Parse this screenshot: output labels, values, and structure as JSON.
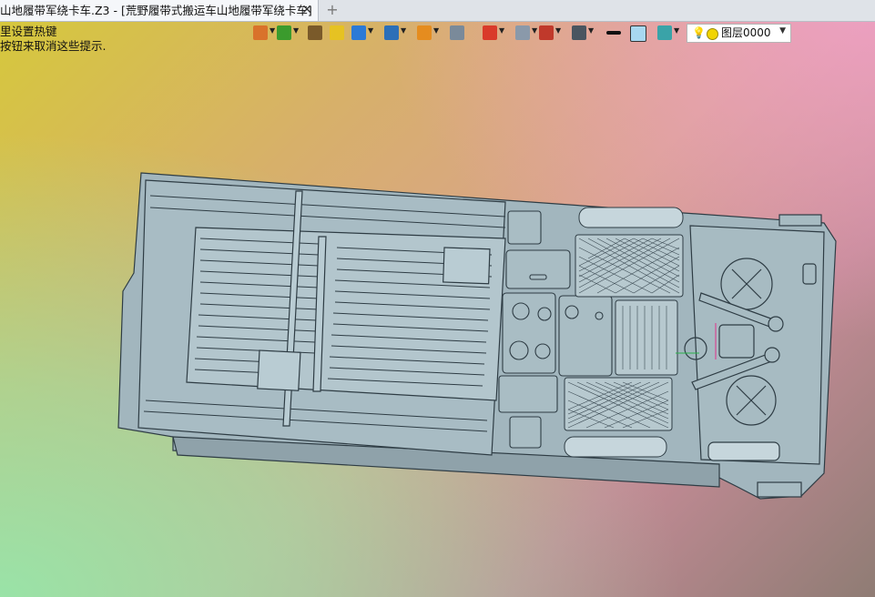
{
  "tab": {
    "title": "山地履带军绕卡车.Z3 - [荒野履带式搬运车山地履带军绕卡车]",
    "close_glyph": "✕",
    "new_tab_glyph": "+"
  },
  "hints": {
    "line1": "里设置热键",
    "line2": "按钮来取消这些提示."
  },
  "toolbar": {
    "icons": [
      {
        "name": "exit-icon",
        "color": "#d9722b"
      },
      {
        "name": "pick-filter-icon",
        "color": "#3b9b2d"
      },
      {
        "name": "brush-icon",
        "color": "#7a5a2a"
      },
      {
        "name": "solid-yellow-icon",
        "color": "#e6c222"
      },
      {
        "name": "solid-blue-icon",
        "color": "#2c7ad6"
      },
      {
        "name": "view-cube-icon",
        "color": "#2c6fb8"
      },
      {
        "name": "pie-icon",
        "color": "#e58c1f"
      },
      {
        "name": "frame-icon",
        "color": "#7a8a9a"
      },
      {
        "name": "target-icon",
        "color": "#d93a2a"
      },
      {
        "name": "window-icon",
        "color": "#8a99aa"
      },
      {
        "name": "dimension-icon",
        "color": "#c0392b"
      },
      {
        "name": "display-icon",
        "color": "#4a5560"
      },
      {
        "name": "line-style-icon",
        "color": "#111111"
      },
      {
        "name": "color-swatch-icon",
        "color": "#a8d8f0"
      },
      {
        "name": "layer-stack-icon",
        "color": "#3aa3a8"
      }
    ],
    "layer_label": "图层0000"
  },
  "colors": {
    "model_fill": "#a4b8c0",
    "model_line": "#2e3c44"
  }
}
